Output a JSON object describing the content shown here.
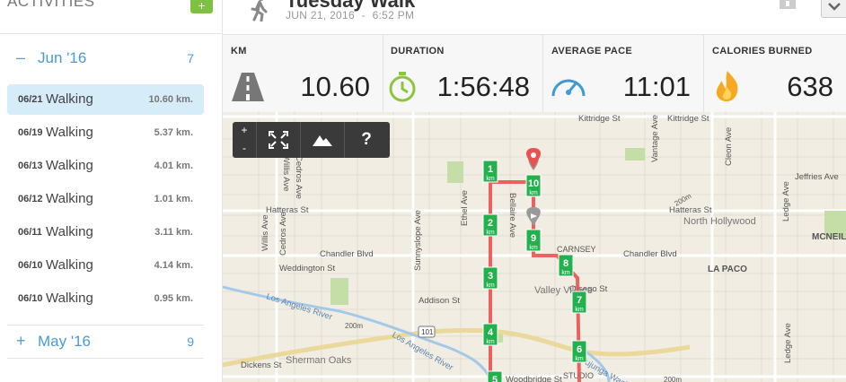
{
  "sidebar": {
    "title": "ACTIVITIES",
    "add_label": "+",
    "months": [
      {
        "toggle": "–",
        "label": "Jun '16",
        "count": "7"
      },
      {
        "toggle": "+",
        "label": "May '16",
        "count": "9"
      }
    ],
    "activities": [
      {
        "date": "06/21",
        "type": "Walking",
        "distance": "10.60 km."
      },
      {
        "date": "06/19",
        "type": "Walking",
        "distance": "5.37 km."
      },
      {
        "date": "06/13",
        "type": "Walking",
        "distance": "4.01 km."
      },
      {
        "date": "06/12",
        "type": "Walking",
        "distance": "1.01 km."
      },
      {
        "date": "06/11",
        "type": "Walking",
        "distance": "3.11 km."
      },
      {
        "date": "06/10",
        "type": "Walking",
        "distance": "4.14 km."
      },
      {
        "date": "06/10",
        "type": "Walking",
        "distance": "0.95 km."
      }
    ],
    "selected_index": 0
  },
  "header": {
    "title": "Tuesday Walk",
    "date": "JUN 21, 2016",
    "separator": "-",
    "time": "6:52 PM"
  },
  "stats": [
    {
      "label": "KM",
      "value": "10.60",
      "icon": "road-icon"
    },
    {
      "label": "DURATION",
      "value": "1:56:48",
      "icon": "stopwatch-icon"
    },
    {
      "label": "AVERAGE PACE",
      "value": "11:01",
      "icon": "speedometer-icon"
    },
    {
      "label": "CALORIES BURNED",
      "value": "638",
      "icon": "flame-icon"
    }
  ],
  "map": {
    "controls": {
      "zoom_in": "+",
      "zoom_out": "-",
      "help": "?"
    },
    "streets": {
      "kittridge1": "Kittridge St",
      "kittridge2": "Kittridge St",
      "hatteras1": "Hatteras St",
      "hatteras2": "Hatteras St",
      "chandler1": "Chandler Blvd",
      "chandler2": "Chandler Blvd",
      "weddington": "Weddington St",
      "addison": "Addison St",
      "oxnard": "Otsego St",
      "dickens": "Dickens St",
      "woodbridge": "Woodbridge St",
      "willis": "Willis Ave",
      "cedros": "Cedros Ave",
      "sunnyslope": "Sunnyslope Ave",
      "ethel": "Ethel Ave",
      "bellaire": "Bellaire Ave",
      "cleon": "Cleon Ave",
      "vantage": "Vantage Ave",
      "ledge": "Ledge Ave",
      "jeffries": "Jeffries Ave",
      "river1": "Los Angeles River",
      "river2": "Los Angeles River",
      "tujunga": "Tujunga Wash",
      "m200a": "200m",
      "m200b": "200m",
      "hwy": "101"
    },
    "places": {
      "valley_village": "Valley Village",
      "north_hollywood": "North Hollywood",
      "sherman_oaks": "Sherman Oaks",
      "studio_city": "STUDIO",
      "la_paco": "LA PACO",
      "mcneil": "MCNEIL",
      "carnsey": "CARNSEY"
    },
    "km_markers": [
      "1",
      "2",
      "3",
      "4",
      "5",
      "6",
      "7",
      "8",
      "9",
      "10"
    ],
    "km_unit": "km"
  },
  "colors": {
    "accent": "#4a9ad8",
    "route": "#e8534f",
    "marker": "#22b14c",
    "selected_row": "#d6ecf9"
  }
}
